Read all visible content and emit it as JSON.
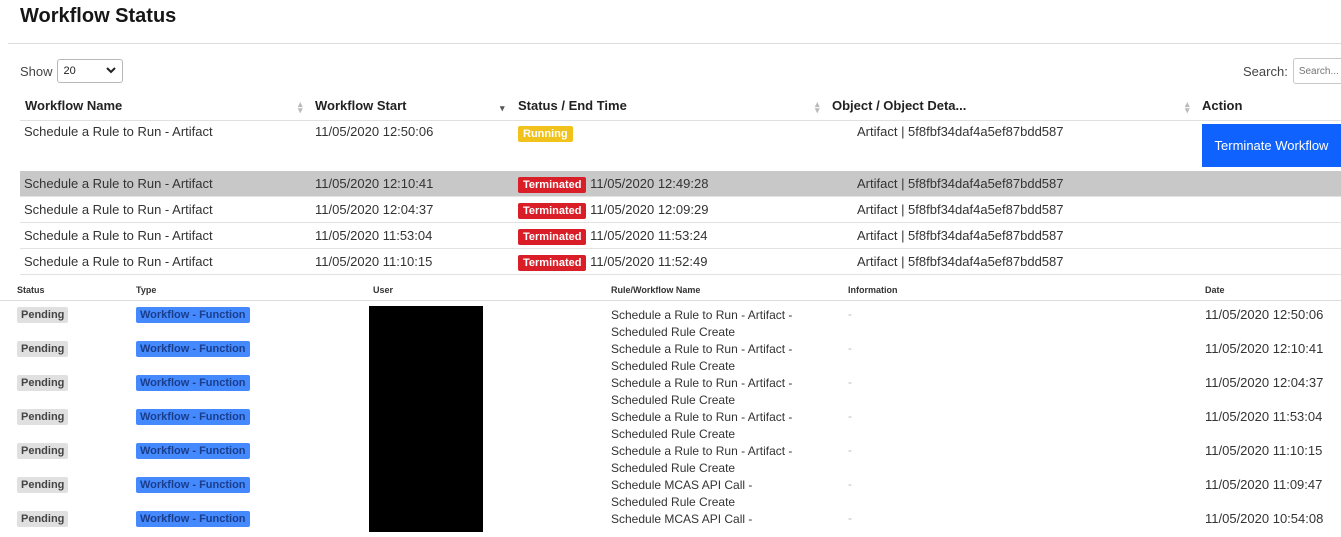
{
  "page": {
    "title": "Workflow Status"
  },
  "controls": {
    "show_label": "Show",
    "show_value": "20",
    "search_label": "Search:",
    "search_placeholder": "Search..."
  },
  "workflow_table": {
    "columns": [
      "Workflow Name",
      "Workflow Start",
      "Status / End Time",
      "Object / Object Deta...",
      "Action"
    ],
    "rows": [
      {
        "name": "Schedule a Rule to Run - Artifact",
        "start": "11/05/2020 12:50:06",
        "status": "Running",
        "end": "",
        "object": "Artifact | 5f8fbf34daf4a5ef87bdd587",
        "action": "Terminate Workflow"
      },
      {
        "name": "Schedule a Rule to Run - Artifact",
        "start": "11/05/2020 12:10:41",
        "status": "Terminated",
        "end": "11/05/2020 12:49:28",
        "object": "Artifact | 5f8fbf34daf4a5ef87bdd587",
        "action": ""
      },
      {
        "name": "Schedule a Rule to Run - Artifact",
        "start": "11/05/2020 12:04:37",
        "status": "Terminated",
        "end": "11/05/2020 12:09:29",
        "object": "Artifact | 5f8fbf34daf4a5ef87bdd587",
        "action": ""
      },
      {
        "name": "Schedule a Rule to Run - Artifact",
        "start": "11/05/2020 11:53:04",
        "status": "Terminated",
        "end": "11/05/2020 11:53:24",
        "object": "Artifact | 5f8fbf34daf4a5ef87bdd587",
        "action": ""
      },
      {
        "name": "Schedule a Rule to Run - Artifact",
        "start": "11/05/2020 11:10:15",
        "status": "Terminated",
        "end": "11/05/2020 11:52:49",
        "object": "Artifact | 5f8fbf34daf4a5ef87bdd587",
        "action": ""
      }
    ]
  },
  "log_table": {
    "columns": [
      "Status",
      "Type",
      "User",
      "Rule/Workflow Name",
      "Information",
      "Date"
    ],
    "rows": [
      {
        "status": "Pending",
        "type": "Workflow - Function",
        "rule_line1": "Schedule a Rule to Run - Artifact -",
        "rule_line2": "Scheduled Rule Create",
        "info": "-",
        "date": "11/05/2020 12:50:06"
      },
      {
        "status": "Pending",
        "type": "Workflow - Function",
        "rule_line1": "Schedule a Rule to Run - Artifact -",
        "rule_line2": "Scheduled Rule Create",
        "info": "-",
        "date": "11/05/2020 12:10:41"
      },
      {
        "status": "Pending",
        "type": "Workflow - Function",
        "rule_line1": "Schedule a Rule to Run - Artifact -",
        "rule_line2": "Scheduled Rule Create",
        "info": "-",
        "date": "11/05/2020 12:04:37"
      },
      {
        "status": "Pending",
        "type": "Workflow - Function",
        "rule_line1": "Schedule a Rule to Run - Artifact -",
        "rule_line2": "Scheduled Rule Create",
        "info": "-",
        "date": "11/05/2020 11:53:04"
      },
      {
        "status": "Pending",
        "type": "Workflow - Function",
        "rule_line1": "Schedule a Rule to Run - Artifact -",
        "rule_line2": "Scheduled Rule Create",
        "info": "-",
        "date": "11/05/2020 11:10:15"
      },
      {
        "status": "Pending",
        "type": "Workflow - Function",
        "rule_line1": "Schedule MCAS API Call -",
        "rule_line2": "Scheduled Rule Create",
        "info": "-",
        "date": "11/05/2020 11:09:47"
      },
      {
        "status": "Pending",
        "type": "Workflow - Function",
        "rule_line1": "Schedule MCAS API Call -",
        "rule_line2": "",
        "info": "-",
        "date": "11/05/2020 10:54:08"
      }
    ]
  },
  "colors": {
    "running": "#f1c21b",
    "terminated": "#da1e28",
    "primary_button": "#0f62fe",
    "type_tag": "#4589ff",
    "selected_row": "#c8c8c8"
  }
}
